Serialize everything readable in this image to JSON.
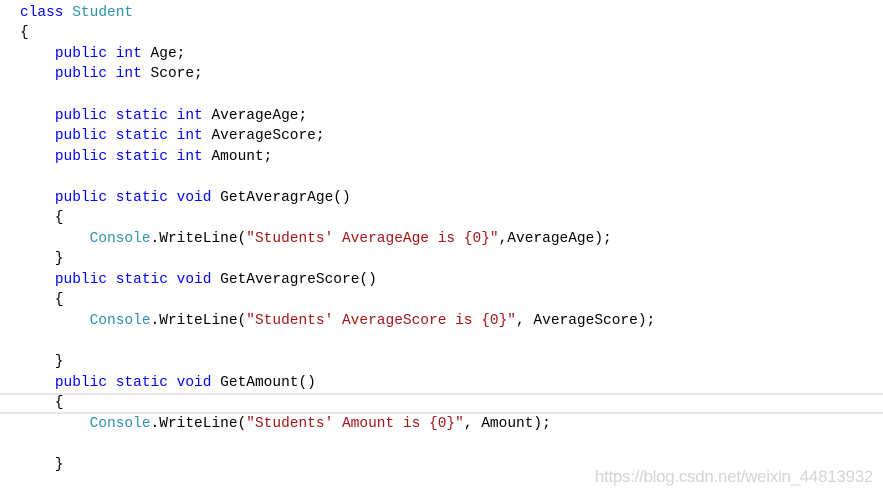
{
  "editor": {
    "current_line": 19,
    "colors": {
      "keyword": "#0000ff",
      "type": "#2b91af",
      "string": "#a31515",
      "text": "#000000",
      "current_line_border": "#e4e4ec"
    },
    "lines": [
      [
        [
          "kw",
          "class"
        ],
        [
          "txt",
          " "
        ],
        [
          "type",
          "Student"
        ]
      ],
      [
        [
          "txt",
          "{"
        ]
      ],
      [
        [
          "txt",
          "    "
        ],
        [
          "kw",
          "public"
        ],
        [
          "txt",
          " "
        ],
        [
          "kw",
          "int"
        ],
        [
          "txt",
          " Age;"
        ]
      ],
      [
        [
          "txt",
          "    "
        ],
        [
          "kw",
          "public"
        ],
        [
          "txt",
          " "
        ],
        [
          "kw",
          "int"
        ],
        [
          "txt",
          " Score;"
        ]
      ],
      [],
      [
        [
          "txt",
          "    "
        ],
        [
          "kw",
          "public"
        ],
        [
          "txt",
          " "
        ],
        [
          "kw",
          "static"
        ],
        [
          "txt",
          " "
        ],
        [
          "kw",
          "int"
        ],
        [
          "txt",
          " AverageAge;"
        ]
      ],
      [
        [
          "txt",
          "    "
        ],
        [
          "kw",
          "public"
        ],
        [
          "txt",
          " "
        ],
        [
          "kw",
          "static"
        ],
        [
          "txt",
          " "
        ],
        [
          "kw",
          "int"
        ],
        [
          "txt",
          " AverageScore;"
        ]
      ],
      [
        [
          "txt",
          "    "
        ],
        [
          "kw",
          "public"
        ],
        [
          "txt",
          " "
        ],
        [
          "kw",
          "static"
        ],
        [
          "txt",
          " "
        ],
        [
          "kw",
          "int"
        ],
        [
          "txt",
          " Amount;"
        ]
      ],
      [],
      [
        [
          "txt",
          "    "
        ],
        [
          "kw",
          "public"
        ],
        [
          "txt",
          " "
        ],
        [
          "kw",
          "static"
        ],
        [
          "txt",
          " "
        ],
        [
          "kw",
          "void"
        ],
        [
          "txt",
          " GetAveragrAge()"
        ]
      ],
      [
        [
          "txt",
          "    {"
        ]
      ],
      [
        [
          "txt",
          "        "
        ],
        [
          "type",
          "Console"
        ],
        [
          "txt",
          ".WriteLine("
        ],
        [
          "str",
          "\"Students' AverageAge is {0}\""
        ],
        [
          "txt",
          ",AverageAge);"
        ]
      ],
      [
        [
          "txt",
          "    }"
        ]
      ],
      [
        [
          "txt",
          "    "
        ],
        [
          "kw",
          "public"
        ],
        [
          "txt",
          " "
        ],
        [
          "kw",
          "static"
        ],
        [
          "txt",
          " "
        ],
        [
          "kw",
          "void"
        ],
        [
          "txt",
          " GetAveragreScore()"
        ]
      ],
      [
        [
          "txt",
          "    {"
        ]
      ],
      [
        [
          "txt",
          "        "
        ],
        [
          "type",
          "Console"
        ],
        [
          "txt",
          ".WriteLine("
        ],
        [
          "str",
          "\"Students' AverageScore is {0}\""
        ],
        [
          "txt",
          ", AverageScore);"
        ]
      ],
      [],
      [
        [
          "txt",
          "    }"
        ]
      ],
      [
        [
          "txt",
          "    "
        ],
        [
          "kw",
          "public"
        ],
        [
          "txt",
          " "
        ],
        [
          "kw",
          "static"
        ],
        [
          "txt",
          " "
        ],
        [
          "kw",
          "void"
        ],
        [
          "txt",
          " GetAmount()"
        ]
      ],
      [
        [
          "txt",
          "    {"
        ]
      ],
      [
        [
          "txt",
          "        "
        ],
        [
          "type",
          "Console"
        ],
        [
          "txt",
          ".WriteLine("
        ],
        [
          "str",
          "\"Students' Amount is {0}\""
        ],
        [
          "txt",
          ", Amount);"
        ]
      ],
      [],
      [
        [
          "txt",
          "    }"
        ]
      ]
    ]
  },
  "watermark": "https://blog.csdn.net/weixin_44813932"
}
